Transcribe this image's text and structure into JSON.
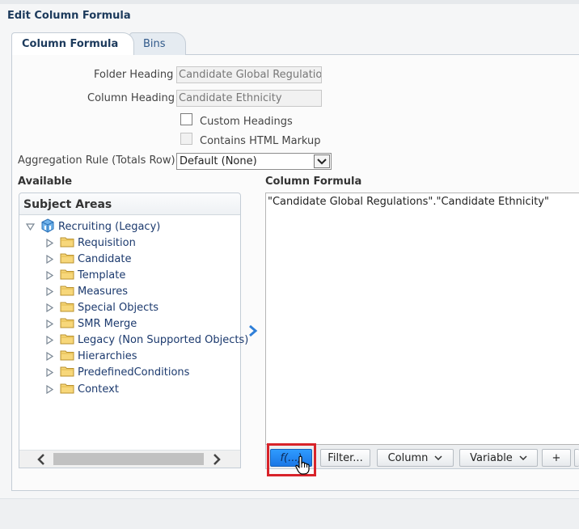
{
  "dialog": {
    "title": "Edit Column Formula"
  },
  "tabs": [
    {
      "label": "Column Formula",
      "active": true
    },
    {
      "label": "Bins",
      "active": false
    }
  ],
  "form": {
    "folder_heading_label": "Folder Heading",
    "folder_heading_value": "Candidate Global Regulations",
    "column_heading_label": "Column Heading",
    "column_heading_value": "Candidate Ethnicity",
    "custom_headings_label": "Custom Headings",
    "custom_headings_checked": false,
    "html_markup_label": "Contains HTML Markup",
    "html_markup_checked": false,
    "aggregation_label": "Aggregation Rule (Totals Row)",
    "aggregation_value": "Default (None)"
  },
  "available": {
    "heading": "Available",
    "subject_areas_title": "Subject Areas",
    "root": "Recruiting (Legacy)",
    "folders": [
      "Requisition",
      "Candidate",
      "Template",
      "Measures",
      "Special Objects",
      "SMR Merge",
      "Legacy (Non Supported Objects)",
      "Hierarchies",
      "PredefinedConditions",
      "Context"
    ]
  },
  "formula": {
    "heading": "Column Formula",
    "text": "\"Candidate Global Regulations\".\"Candidate Ethnicity\""
  },
  "toolbar": {
    "fx_label": "f(...)",
    "filter_label": "Filter...",
    "column_label": "Column",
    "variable_label": "Variable",
    "plus_label": "+"
  },
  "colors": {
    "title": "#1c3a5c",
    "link": "#1c3a6e",
    "fx_button": "#1a77e6",
    "highlight": "#d8232a"
  }
}
